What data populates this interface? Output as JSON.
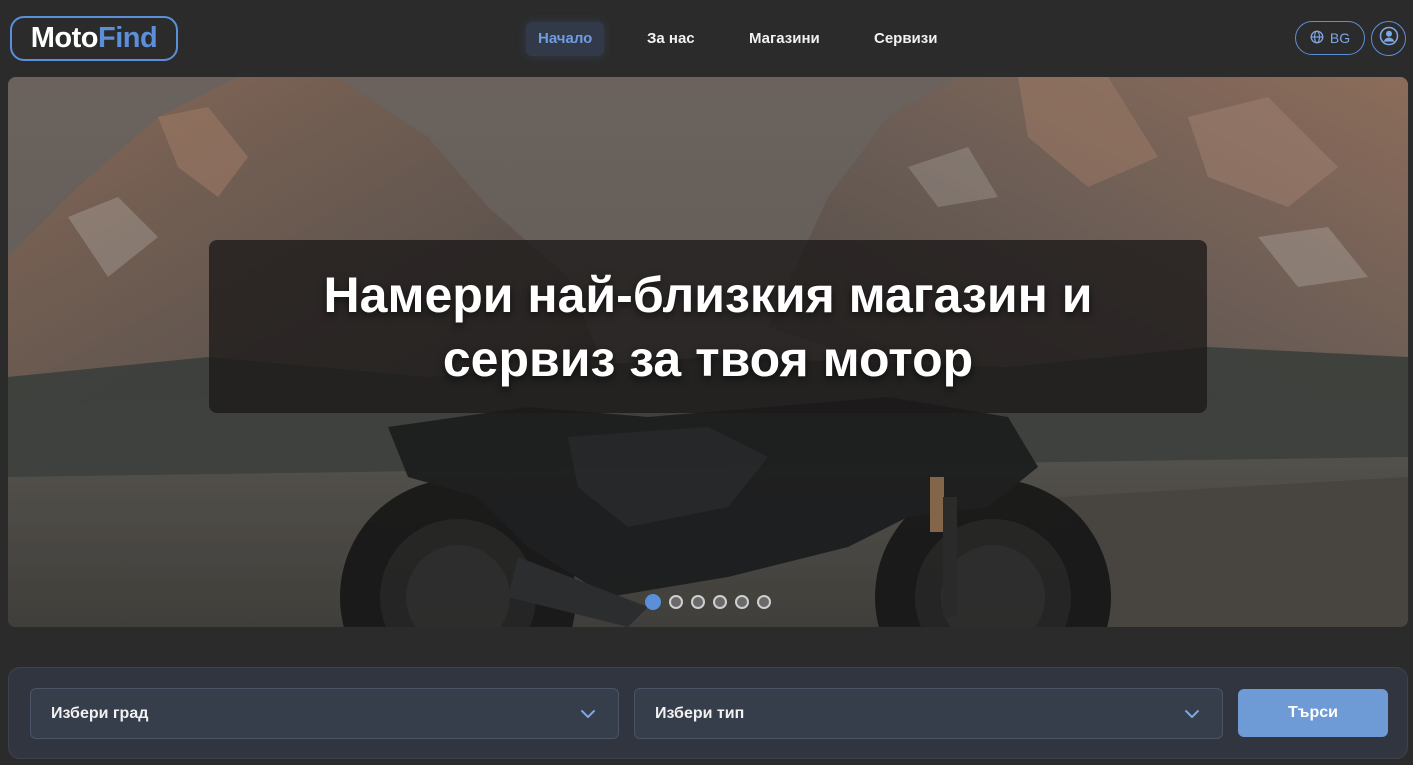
{
  "logo": {
    "part1": "Moto",
    "part2": "Find"
  },
  "nav": {
    "items": [
      {
        "label": "Начало",
        "active": true
      },
      {
        "label": "За нас",
        "active": false
      },
      {
        "label": "Магазини",
        "active": false
      },
      {
        "label": "Сервизи",
        "active": false
      }
    ]
  },
  "language": {
    "label": "BG",
    "icon": "globe-icon"
  },
  "user": {
    "icon": "user-icon"
  },
  "hero": {
    "headline": "Намери най-близкия магазин и сервиз за твоя мотор",
    "slides_total": 6,
    "active_slide": 1
  },
  "search": {
    "city_placeholder": "Избери град",
    "type_placeholder": "Избери тип",
    "button_label": "Търси"
  },
  "colors": {
    "accent": "#5b8fd9",
    "background": "#2b2b2b",
    "panel": "#30353f",
    "button": "#6e9ad6"
  }
}
